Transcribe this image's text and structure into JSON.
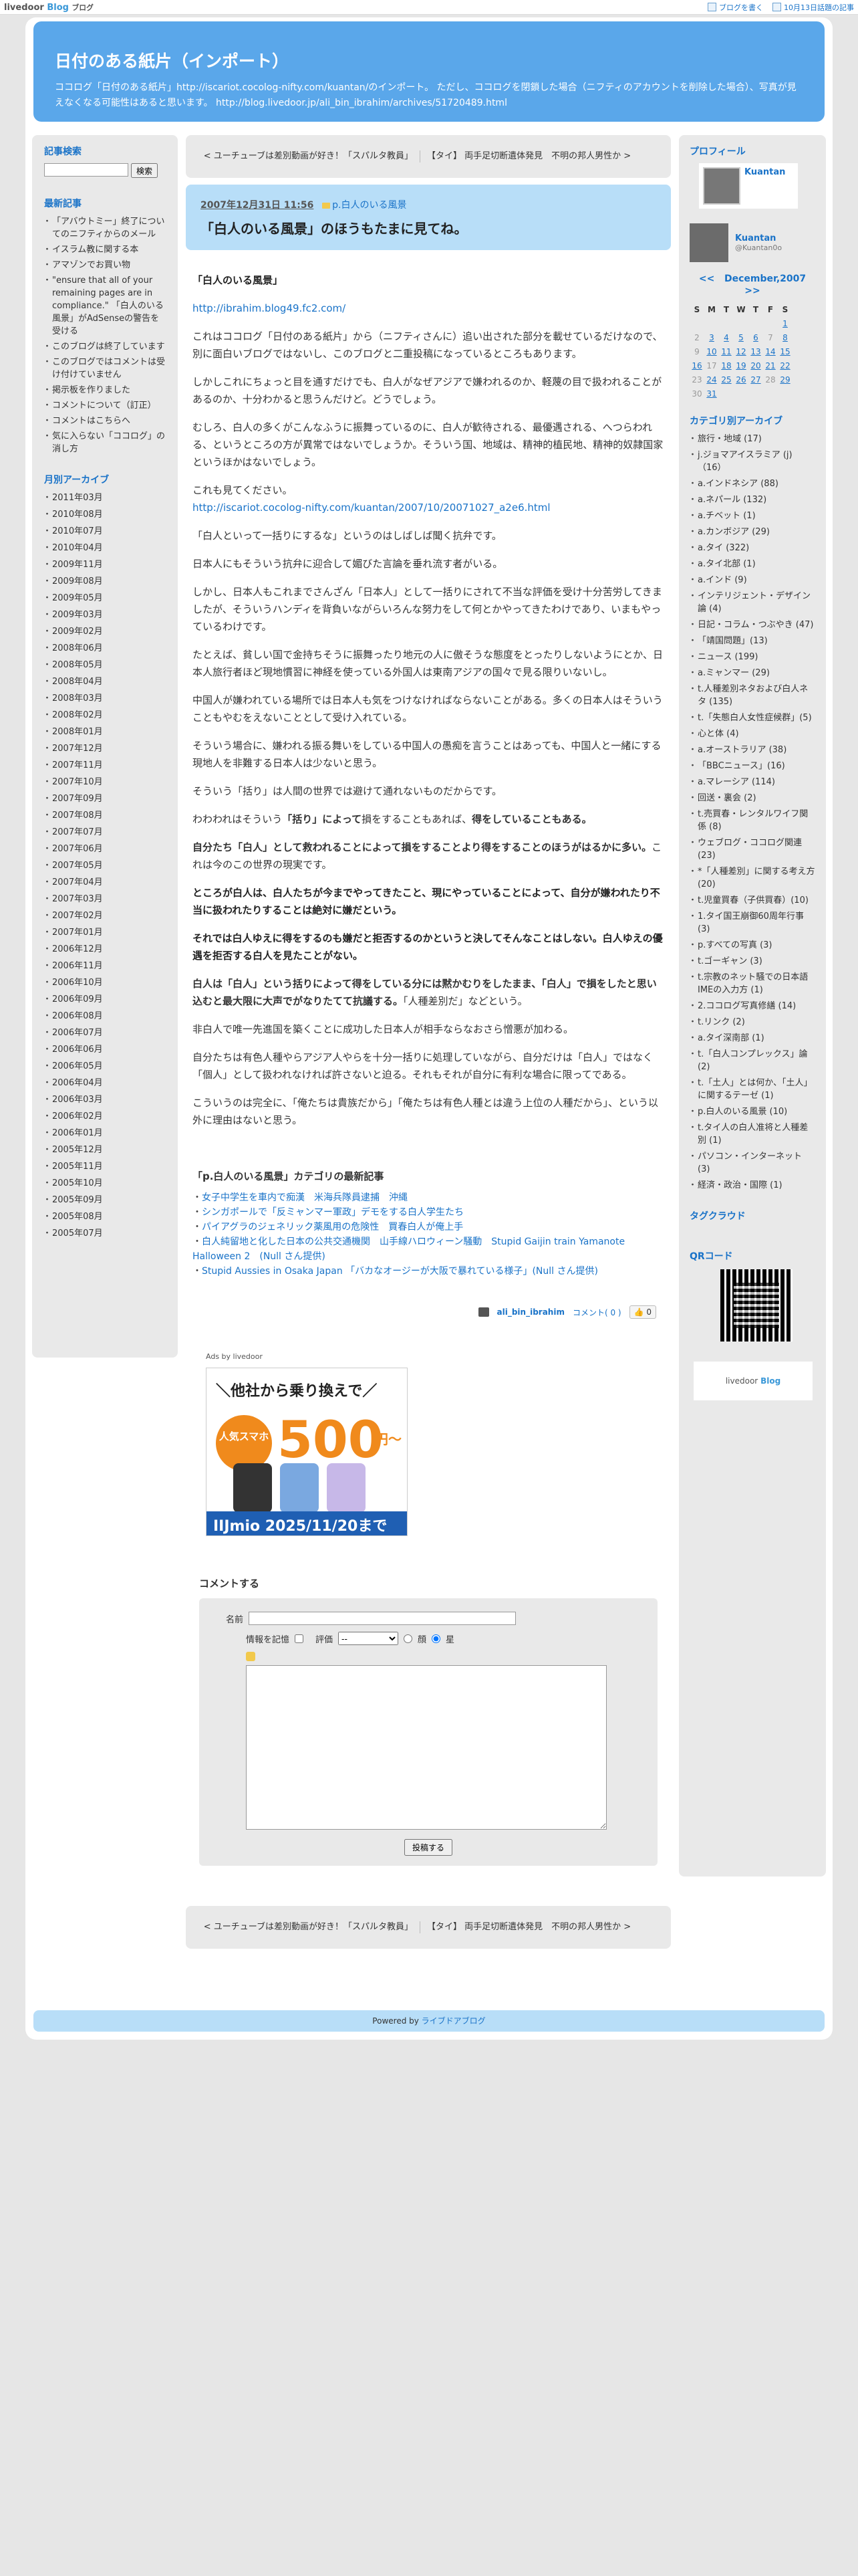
{
  "topbar": {
    "logo_a": "livedoor",
    "logo_b": "Blog",
    "logo_c": "ブログ",
    "write": "ブログを書く",
    "latest": "10月13日話題の記事"
  },
  "header": {
    "title": "日付のある紙片（インポート）",
    "desc": "ココログ「日付のある紙片」http://iscariot.cocolog-nifty.com/kuantan/のインポート。 ただし、ココログを閉鎖した場合（ニフティのアカウントを削除した場合）、写真が見えなくなる可能性はあると思います。 http://blog.livedoor.jp/ali_bin_ibrahim/archives/51720489.html"
  },
  "left": {
    "search_title": "記事検索",
    "search_button": "検索",
    "recent_title": "最新記事",
    "recent": [
      "「アバウトミー」終了についてのニフティからのメール",
      "イスラム教に関する本",
      "アマゾンでお買い物",
      "\"ensure that all of your remaining pages are in compliance.\" 「白人のいる風景」がAdSenseの警告を受ける",
      "このブログは終了しています",
      "このブログではコメントは受け付けていません",
      "掲示板を作りました",
      "コメントについて（訂正）",
      "コメントはこちらへ",
      "気に入らない「ココログ」の消し方"
    ],
    "archive_title": "月別アーカイブ",
    "archives": [
      "2011年03月",
      "2010年08月",
      "2010年07月",
      "2010年04月",
      "2009年11月",
      "2009年08月",
      "2009年05月",
      "2009年03月",
      "2009年02月",
      "2008年06月",
      "2008年05月",
      "2008年04月",
      "2008年03月",
      "2008年02月",
      "2008年01月",
      "2007年12月",
      "2007年11月",
      "2007年10月",
      "2007年09月",
      "2007年08月",
      "2007年07月",
      "2007年06月",
      "2007年05月",
      "2007年04月",
      "2007年03月",
      "2007年02月",
      "2007年01月",
      "2006年12月",
      "2006年11月",
      "2006年10月",
      "2006年09月",
      "2006年08月",
      "2006年07月",
      "2006年06月",
      "2006年05月",
      "2006年04月",
      "2006年03月",
      "2006年02月",
      "2006年01月",
      "2005年12月",
      "2005年11月",
      "2005年10月",
      "2005年09月",
      "2005年08月",
      "2005年07月"
    ]
  },
  "nav": {
    "prev": "< ユーチューブは差別動画が好き！「スパルタ教員」",
    "next": "【タイ】 両手足切断遺体発見　不明の邦人男性か >"
  },
  "post": {
    "date": "2007年12月31日 11:56",
    "category": "p.白人のいる風景",
    "title": "「白人のいる風景」のほうもたまに見てね。",
    "heading": "「白人のいる風景」",
    "link1": "http://ibrahim.blog49.fc2.com/",
    "p1": "これはココログ「日付のある紙片」から（ニフティさんに）追い出された部分を載せているだけなので、別に面白いブログではないし、このブログと二重投稿になっているところもあります。",
    "p2": "しかしこれにちょっと目を通すだけでも、白人がなぜアジアで嫌われるのか、軽蔑の目で扱われることがあるのか、十分わかると思うんだけど。どうでしょう。",
    "p3": "むしろ、白人の多くがこんなふうに振舞っているのに、白人が歓待される、最優遇される、へつらわれる、というところの方が異常ではないでしょうか。そういう国、地域は、精神的植民地、精神的奴隷国家というほかはないでしょう。",
    "p4a": "これも見てください。",
    "link2": "http://iscariot.cocolog-nifty.com/kuantan/2007/10/20071027_a2e6.html",
    "p5": "「白人といって一括りにするな」というのはしばしば聞く抗弁です。",
    "p6": "日本人にもそういう抗弁に迎合して媚びた言論を垂れ流す者がいる。",
    "p7": "しかし、日本人もこれまでさんざん「日本人」として一括りにされて不当な評価を受け十分苦労してきましたが、そういうハンディを背負いながらいろんな努力をして何とかやってきたわけであり、いまもやっているわけです。",
    "p8": "たとえば、貧しい国で金持ちそうに振舞ったり地元の人に傲そうな態度をとったりしないようにとか、日本人旅行者ほど現地慣習に神経を使っている外国人は東南アジアの国々で見る限りいないし。",
    "p9": "中国人が嫌われている場所では日本人も気をつけなければならないことがある。多くの日本人はそういうこともやむをえないこととして受け入れている。",
    "p10": "そういう場合に、嫌われる振る舞いをしている中国人の愚痴を言うことはあっても、中国人と一緒にする現地人を非難する日本人は少ないと思う。",
    "p11": "そういう「括り」は人間の世界では避けて通れないものだからです。",
    "p12a": "わわわれはそういう",
    "p12b": "「括り」によって",
    "p12c": "損をすることもあれば、",
    "p12d": "得をしていることもある。",
    "p13": "自分たち「白人」として救われることによって損をすることより得をすることのほうがはるかに多い。",
    "p13b": "これは今のこの世界の現実です。",
    "p14": "ところが白人は、白人たちが今までやってきたこと、現にやっていることによって、自分が嫌われたり不当に扱われたりすることは絶対に嫌だという。",
    "p15": "それでは白人ゆえに得をするのも嫌だと拒否するのかというと決してそんなことはしない。白人ゆえの優遇を拒否する白人を見たことがない。",
    "p16a": "白人は「白人」という括りによって得をしている分には黙かむりをしたまま、「白人」で損をしたと思い込むと最大限に大声でがなりたてて抗議する。",
    "p16b": "「人種差別だ」などという。",
    "p17": "非白人で唯一先進国を築くことに成功した日本人が相手ならなおさら憎悪が加わる。",
    "p18": "自分たちは有色人種やらアジア人やらを十分一括りに処理していながら、自分だけは「白人」ではなく「個人」として扱われなければ許さないと迫る。それもそれが自分に有利な場合に限ってである。",
    "p19": "こういうのは完全に、「俺たちは貴族だから」「俺たちは有色人種とは違う上位の人種だから」、という以外に理由はないと思う。",
    "recent_title": "「p.白人のいる風景」カテゴリの最新記事",
    "recent": [
      "女子中学生を車内で痴漢　米海兵隊員逮捕　沖縄",
      "シンガポールで「反ミャンマー軍政」デモをする白人学生たち",
      "パイアグラのジェネリック薬風用の危険性　買春白人が俺上手",
      "白人純留地と化した日本の公共交通機関　山手線ハロウィーン騒動　Stupid Gaijin train Yamanote Halloween 2　(Null さん提供)",
      "Stupid Aussies in Osaka Japan 「バカなオージーが大阪で暴れている様子」(Null さん提供)"
    ],
    "author": "ali_bin_ibrahim",
    "comments": "コメント( 0 )",
    "like": "👍 0"
  },
  "ads": {
    "label": "Ads by livedoor",
    "headline": "＼他社から乗り換えで／",
    "badge": "人気スマホ",
    "price": "500",
    "yen": "円〜",
    "footer": "IIJmio  2025/11/20まで"
  },
  "comment_form": {
    "title": "コメントする",
    "name_label": "名前",
    "remember_label": "情報を記憶",
    "rating_label": "評価",
    "rating_value": "--",
    "opt_bad": "顔",
    "opt_star": "星",
    "submit": "投稿する"
  },
  "footer": {
    "text": "Powered by ",
    "link": "ライブドアブログ"
  },
  "right": {
    "profile_title": "プロフィール",
    "name": "Kuantan",
    "handle": "@Kuantan0o",
    "cal_prev": "<<",
    "cal_month": "December,2007",
    "cal_next": ">>",
    "weekdays": [
      "S",
      "M",
      "T",
      "W",
      "T",
      "F",
      "S"
    ],
    "weeks": [
      [
        "",
        "",
        "",
        "",
        "",
        "",
        "1"
      ],
      [
        "2",
        "3",
        "4",
        "5",
        "6",
        "7",
        "8"
      ],
      [
        "9",
        "10",
        "11",
        "12",
        "13",
        "14",
        "15"
      ],
      [
        "16",
        "17",
        "18",
        "19",
        "20",
        "21",
        "22"
      ],
      [
        "23",
        "24",
        "25",
        "26",
        "27",
        "28",
        "29"
      ],
      [
        "30",
        "31",
        "",
        "",
        "",
        "",
        ""
      ]
    ],
    "cat_title": "カテゴリ別アーカイブ",
    "cats": [
      "旅行・地域 (17)",
      "j.ジョマアイスラミア (j)（16）",
      "a.インドネシア (88)",
      "a.ネパール (132)",
      "a.チベット (1)",
      "a.カンボジア (29)",
      "a.タイ (322)",
      "a.タイ北部 (1)",
      "a.インド (9)",
      "インテリジェント・デザイン論 (4)",
      "日記・コラム・つぶやき (47)",
      "「靖国問題」(13)",
      "ニュース (199)",
      "a.ミャンマー (29)",
      "t.人種差別ネタおよび白人ネタ (135)",
      "t.「失態白人女性症候群」(5)",
      "心と体 (4)",
      "a.オーストラリア (38)",
      "「BBCニュース」(16)",
      "a.マレーシア (114)",
      "回送・裏会 (2)",
      "t.売買春・レンタルワイフ関係 (8)",
      "ウェブログ・ココログ関連 (23)",
      "*「人種差別」に関する考え方 (20)",
      "t.児童買春（子供買春）(10)",
      "1.タイ国王崩御60周年行事 (3)",
      "p.すべての写真 (3)",
      "t.ゴーギャン (3)",
      "t.宗教のネット騒での日本語IMEの入力方 (1)",
      "2.ココログ写真修繕 (14)",
      "t.リンク (2)",
      "a.タイ深南部 (1)",
      "t.「白人コンプレックス」論 (2)",
      "t.「土人」とは何か、「土人」に関するテーゼ (1)",
      "p.白人のいる風景 (10)",
      "t.タイ人の白人准将と人種差別 (1)",
      "パソコン・インターネット (3)",
      "経済・政治・国際 (1)"
    ],
    "tag_title": "タグクラウド",
    "qr_title": "QRコード",
    "ldr_a": "livedoor",
    "ldr_b": "Blog"
  }
}
